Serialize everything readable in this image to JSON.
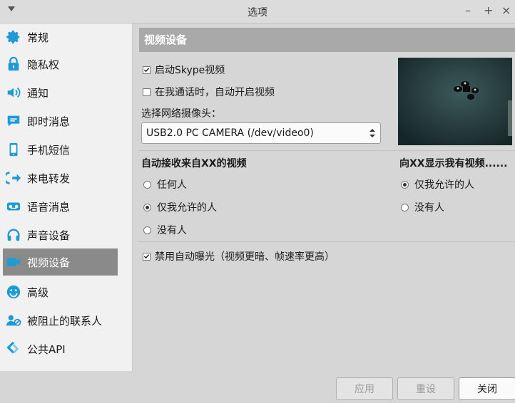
{
  "window": {
    "title": "选项"
  },
  "sidebar": {
    "items": [
      {
        "label": "常规",
        "icon": "gear-icon"
      },
      {
        "label": "隐私权",
        "icon": "lock-icon"
      },
      {
        "label": "通知",
        "icon": "speaker-icon"
      },
      {
        "label": "即时消息",
        "icon": "chat-icon"
      },
      {
        "label": "手机短信",
        "icon": "phone-icon"
      },
      {
        "label": "来电转发",
        "icon": "call-forward-icon"
      },
      {
        "label": "语音消息",
        "icon": "voicemail-icon"
      },
      {
        "label": "声音设备",
        "icon": "headset-icon"
      },
      {
        "label": "视频设备",
        "icon": "video-camera-icon",
        "active": true
      },
      {
        "label": "高级",
        "icon": "smiley-icon"
      },
      {
        "label": "被阻止的联系人",
        "icon": "blocked-contact-icon"
      },
      {
        "label": "公共API",
        "icon": "api-icon"
      }
    ]
  },
  "video": {
    "header": "视频设备",
    "enable_video": {
      "label": "启动Skype视频",
      "checked": true
    },
    "auto_start": {
      "label": "在我通话时，自动开启视频",
      "checked": false
    },
    "camera_label": "选择网络摄像头：",
    "camera_value": "USB2.0 PC CAMERA (/dev/video0)",
    "receive": {
      "title": "自动接收来自XX的视频",
      "options": [
        "任何人",
        "仅我允许的人",
        "没有人"
      ],
      "selected": 1
    },
    "show": {
      "title": "向XX显示我有视频......",
      "options": [
        "仅我允许的人",
        "没有人"
      ],
      "selected": 0
    },
    "disable_exposure": {
      "label": "禁用自动曝光（视频更暗、帧速率更高）",
      "checked": true
    }
  },
  "footer": {
    "apply": "应用",
    "reset": "重设",
    "close": "关闭"
  },
  "colors": {
    "active_nav": "#8a8a8a",
    "header_bg": "#a9a9a9",
    "accent_icon": "#1e9ad6"
  }
}
